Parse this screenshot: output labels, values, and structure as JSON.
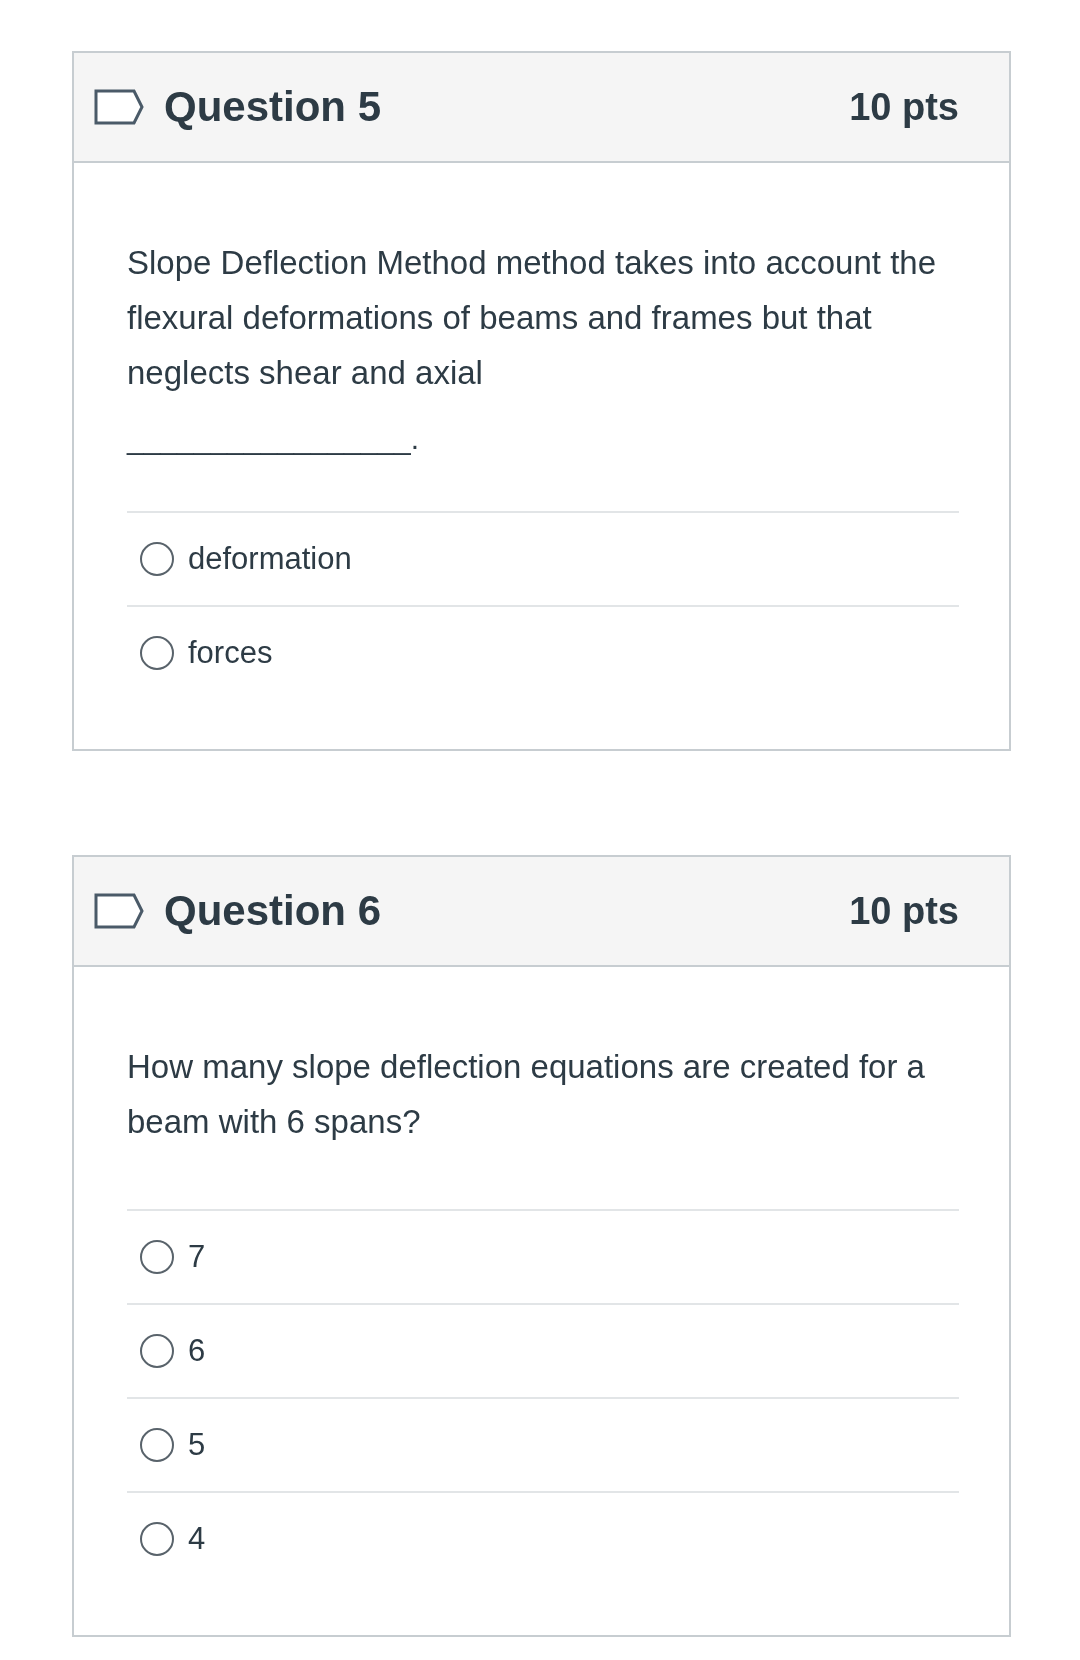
{
  "questions": [
    {
      "title": "Question 5",
      "points": "10 pts",
      "text": "Slope Deflection Method method takes into account the flexural deformations of beams and frames but that neglects shear and axial",
      "blank": "_________________.",
      "answers": [
        {
          "label": "deformation",
          "selected": false
        },
        {
          "label": "forces",
          "selected": false
        }
      ]
    },
    {
      "title": "Question 6",
      "points": "10 pts",
      "text": "How many slope deflection equations are created for a beam with 6 spans?",
      "answers": [
        {
          "label": "7",
          "selected": false
        },
        {
          "label": "6",
          "selected": false
        },
        {
          "label": "5",
          "selected": false
        },
        {
          "label": "4",
          "selected": false
        }
      ]
    }
  ]
}
